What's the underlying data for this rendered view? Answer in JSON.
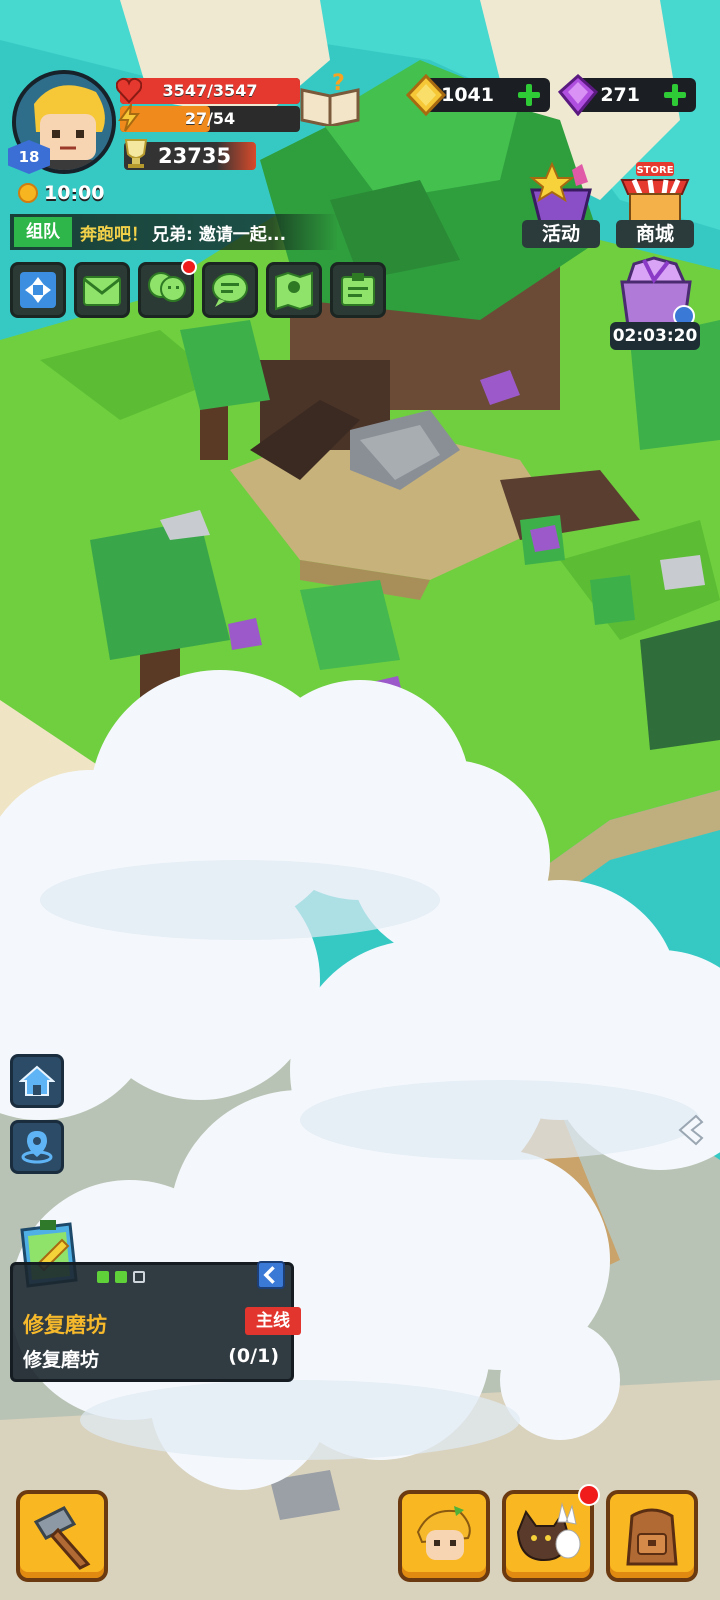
{
  "player": {
    "level": "18",
    "hp": "3547/3547",
    "hp_fraction": 1.0,
    "energy": "27/54",
    "energy_fraction": 0.5,
    "trophies": "23735",
    "time": "10:00"
  },
  "currency": {
    "gold": "1041",
    "gems": "271"
  },
  "team": {
    "tag": "组队",
    "text1": "奔跑吧！",
    "text2": "兄弟: 邀请一起..."
  },
  "top_icons": [
    {
      "name": "expand-icon"
    },
    {
      "name": "mail-icon"
    },
    {
      "name": "friends-icon",
      "badge": true
    },
    {
      "name": "chat-icon"
    },
    {
      "name": "map-icon"
    },
    {
      "name": "id-card-icon"
    }
  ],
  "events": {
    "activity_label": "活动",
    "store_label": "商城",
    "store_sign": "STORE",
    "gift_timer": "02:03:20"
  },
  "quest": {
    "title": "修复磨坊",
    "tag": "主线",
    "description": "修复磨坊",
    "progress": "(0/1)",
    "page_dots": [
      "active",
      "active",
      "inactive"
    ]
  },
  "colors": {
    "hp_bar": "#e5382e",
    "energy_bar": "#f08a1c",
    "grass": "#6fcf3f",
    "water": "#36c9c4",
    "button_yellow": "#f9b822",
    "quest_title": "#f6b92b"
  }
}
